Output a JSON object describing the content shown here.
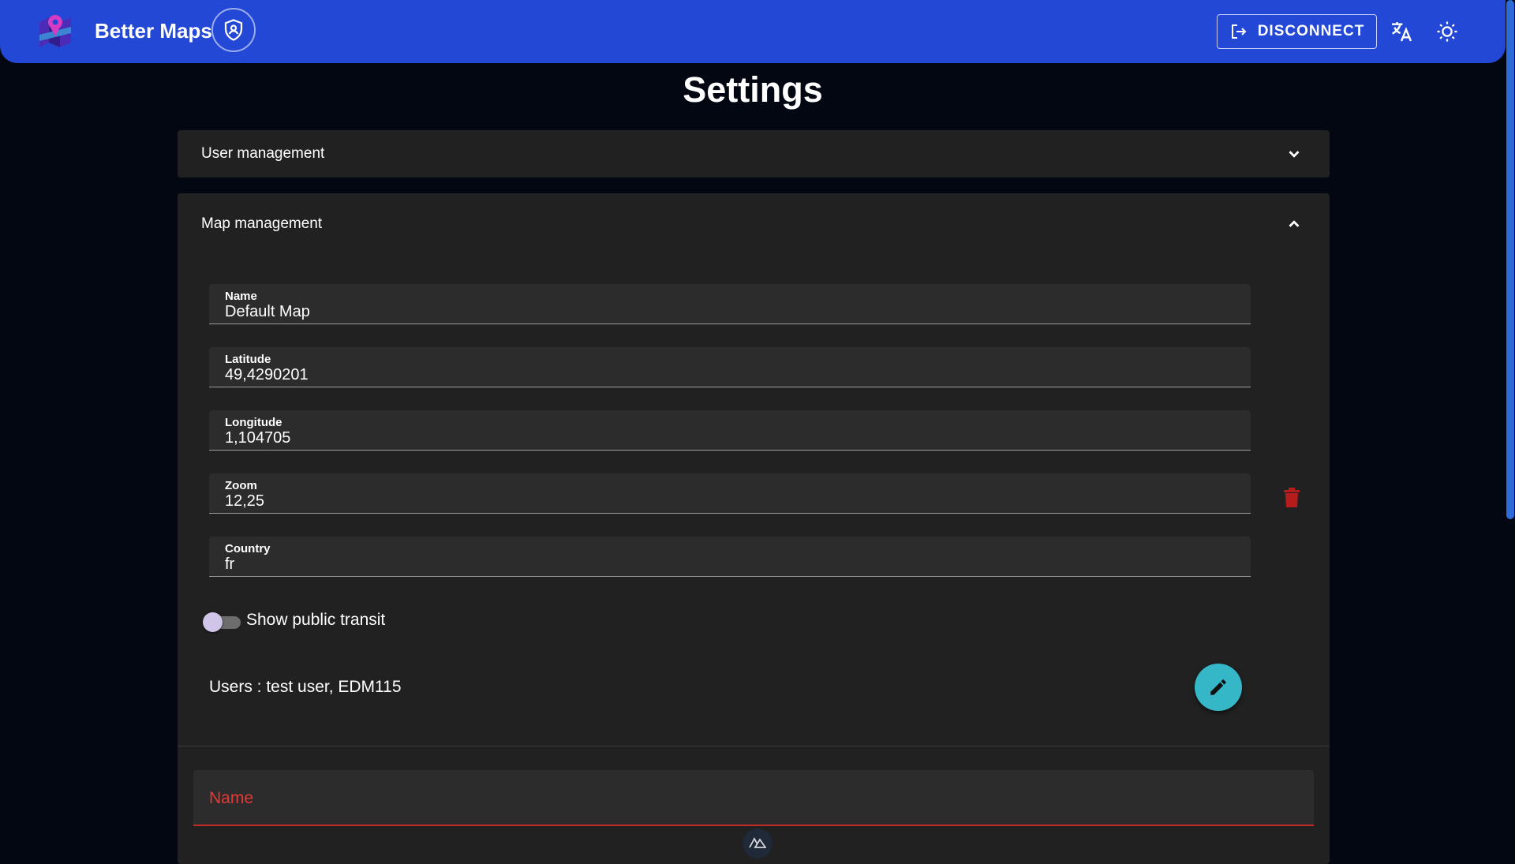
{
  "header": {
    "app_name": "Better Maps",
    "disconnect_label": "DISCONNECT",
    "icons": [
      "app-logo",
      "admin-shield-icon",
      "logout-icon",
      "translate-icon",
      "theme-toggle-icon"
    ],
    "background_color": "#2448d6"
  },
  "page": {
    "title": "Settings"
  },
  "user_management": {
    "title": "User management",
    "expanded": false
  },
  "map_management": {
    "title": "Map management",
    "expanded": true,
    "fields": [
      {
        "label": "Name",
        "value": "Default Map"
      },
      {
        "label": "Latitude",
        "value": "49,4290201"
      },
      {
        "label": "Longitude",
        "value": "1,104705"
      },
      {
        "label": "Zoom",
        "value": "12,25"
      },
      {
        "label": "Country",
        "value": "fr"
      }
    ],
    "show_public_transit": {
      "label": "Show public transit",
      "enabled": false
    },
    "users_line": "Users : test user, EDM115",
    "new_map": {
      "name_label": "Name",
      "error_color": "#e53935"
    }
  },
  "colors": {
    "background": "#030712",
    "panel": "#212121",
    "field": "#2c2c2c",
    "accent_fab": "#36b7c8",
    "delete": "#b71c1c"
  }
}
